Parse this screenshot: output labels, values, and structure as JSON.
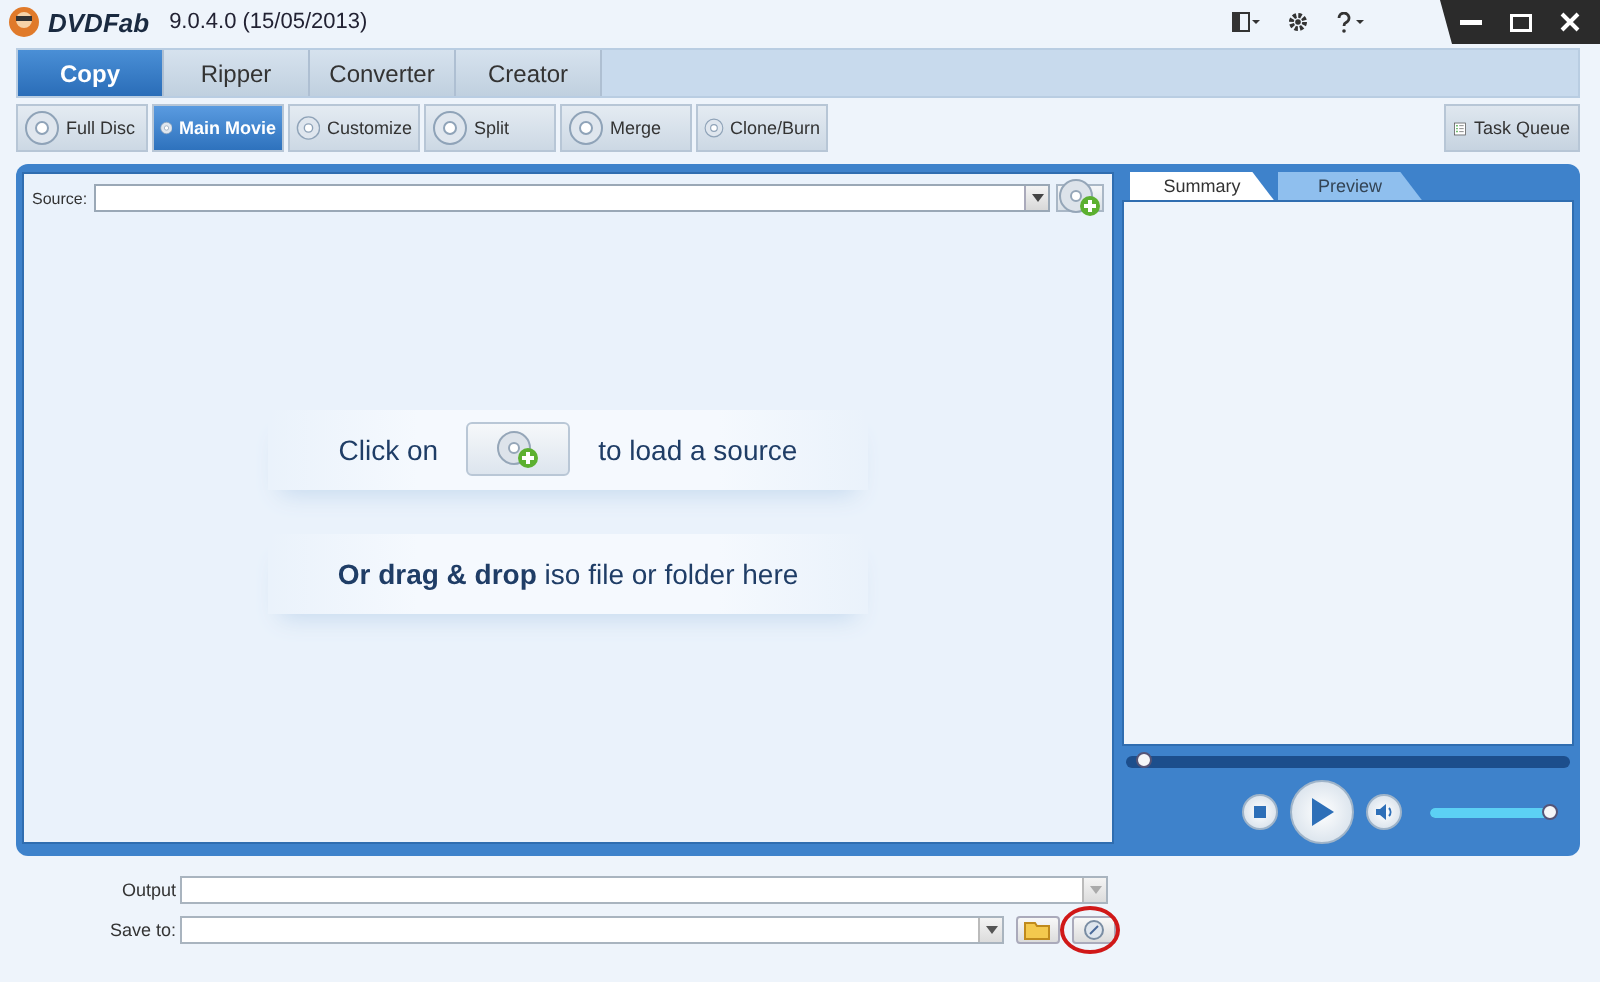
{
  "window": {
    "app_name": "DVDFab",
    "version": "9.0.4.0 (15/05/2013)"
  },
  "tabs": [
    {
      "label": "Copy",
      "selected": true
    },
    {
      "label": "Ripper",
      "selected": false
    },
    {
      "label": "Converter",
      "selected": false
    },
    {
      "label": "Creator",
      "selected": false
    }
  ],
  "modes": [
    {
      "label": "Full Disc",
      "selected": false
    },
    {
      "label": "Main Movie",
      "selected": true
    },
    {
      "label": "Customize",
      "selected": false
    },
    {
      "label": "Split",
      "selected": false
    },
    {
      "label": "Merge",
      "selected": false
    },
    {
      "label": "Clone/Burn",
      "selected": false
    }
  ],
  "task_queue": {
    "label": "Task Queue"
  },
  "source": {
    "label": "Source:"
  },
  "drop_hint": {
    "click_text": "Click on",
    "load_text": "to load a source",
    "drag_text": "**Or drag & drop** iso file or folder here"
  },
  "preview_tabs": [
    {
      "label": "Summary",
      "selected": true
    },
    {
      "label": "Preview",
      "selected": false
    }
  ],
  "player": {
    "seek": {
      "level": 0
    },
    "volume": {
      "level": 1
    }
  },
  "output": {
    "label": "Output"
  },
  "save_to": {
    "label": "Save to:",
    "highlighted": true
  }
}
